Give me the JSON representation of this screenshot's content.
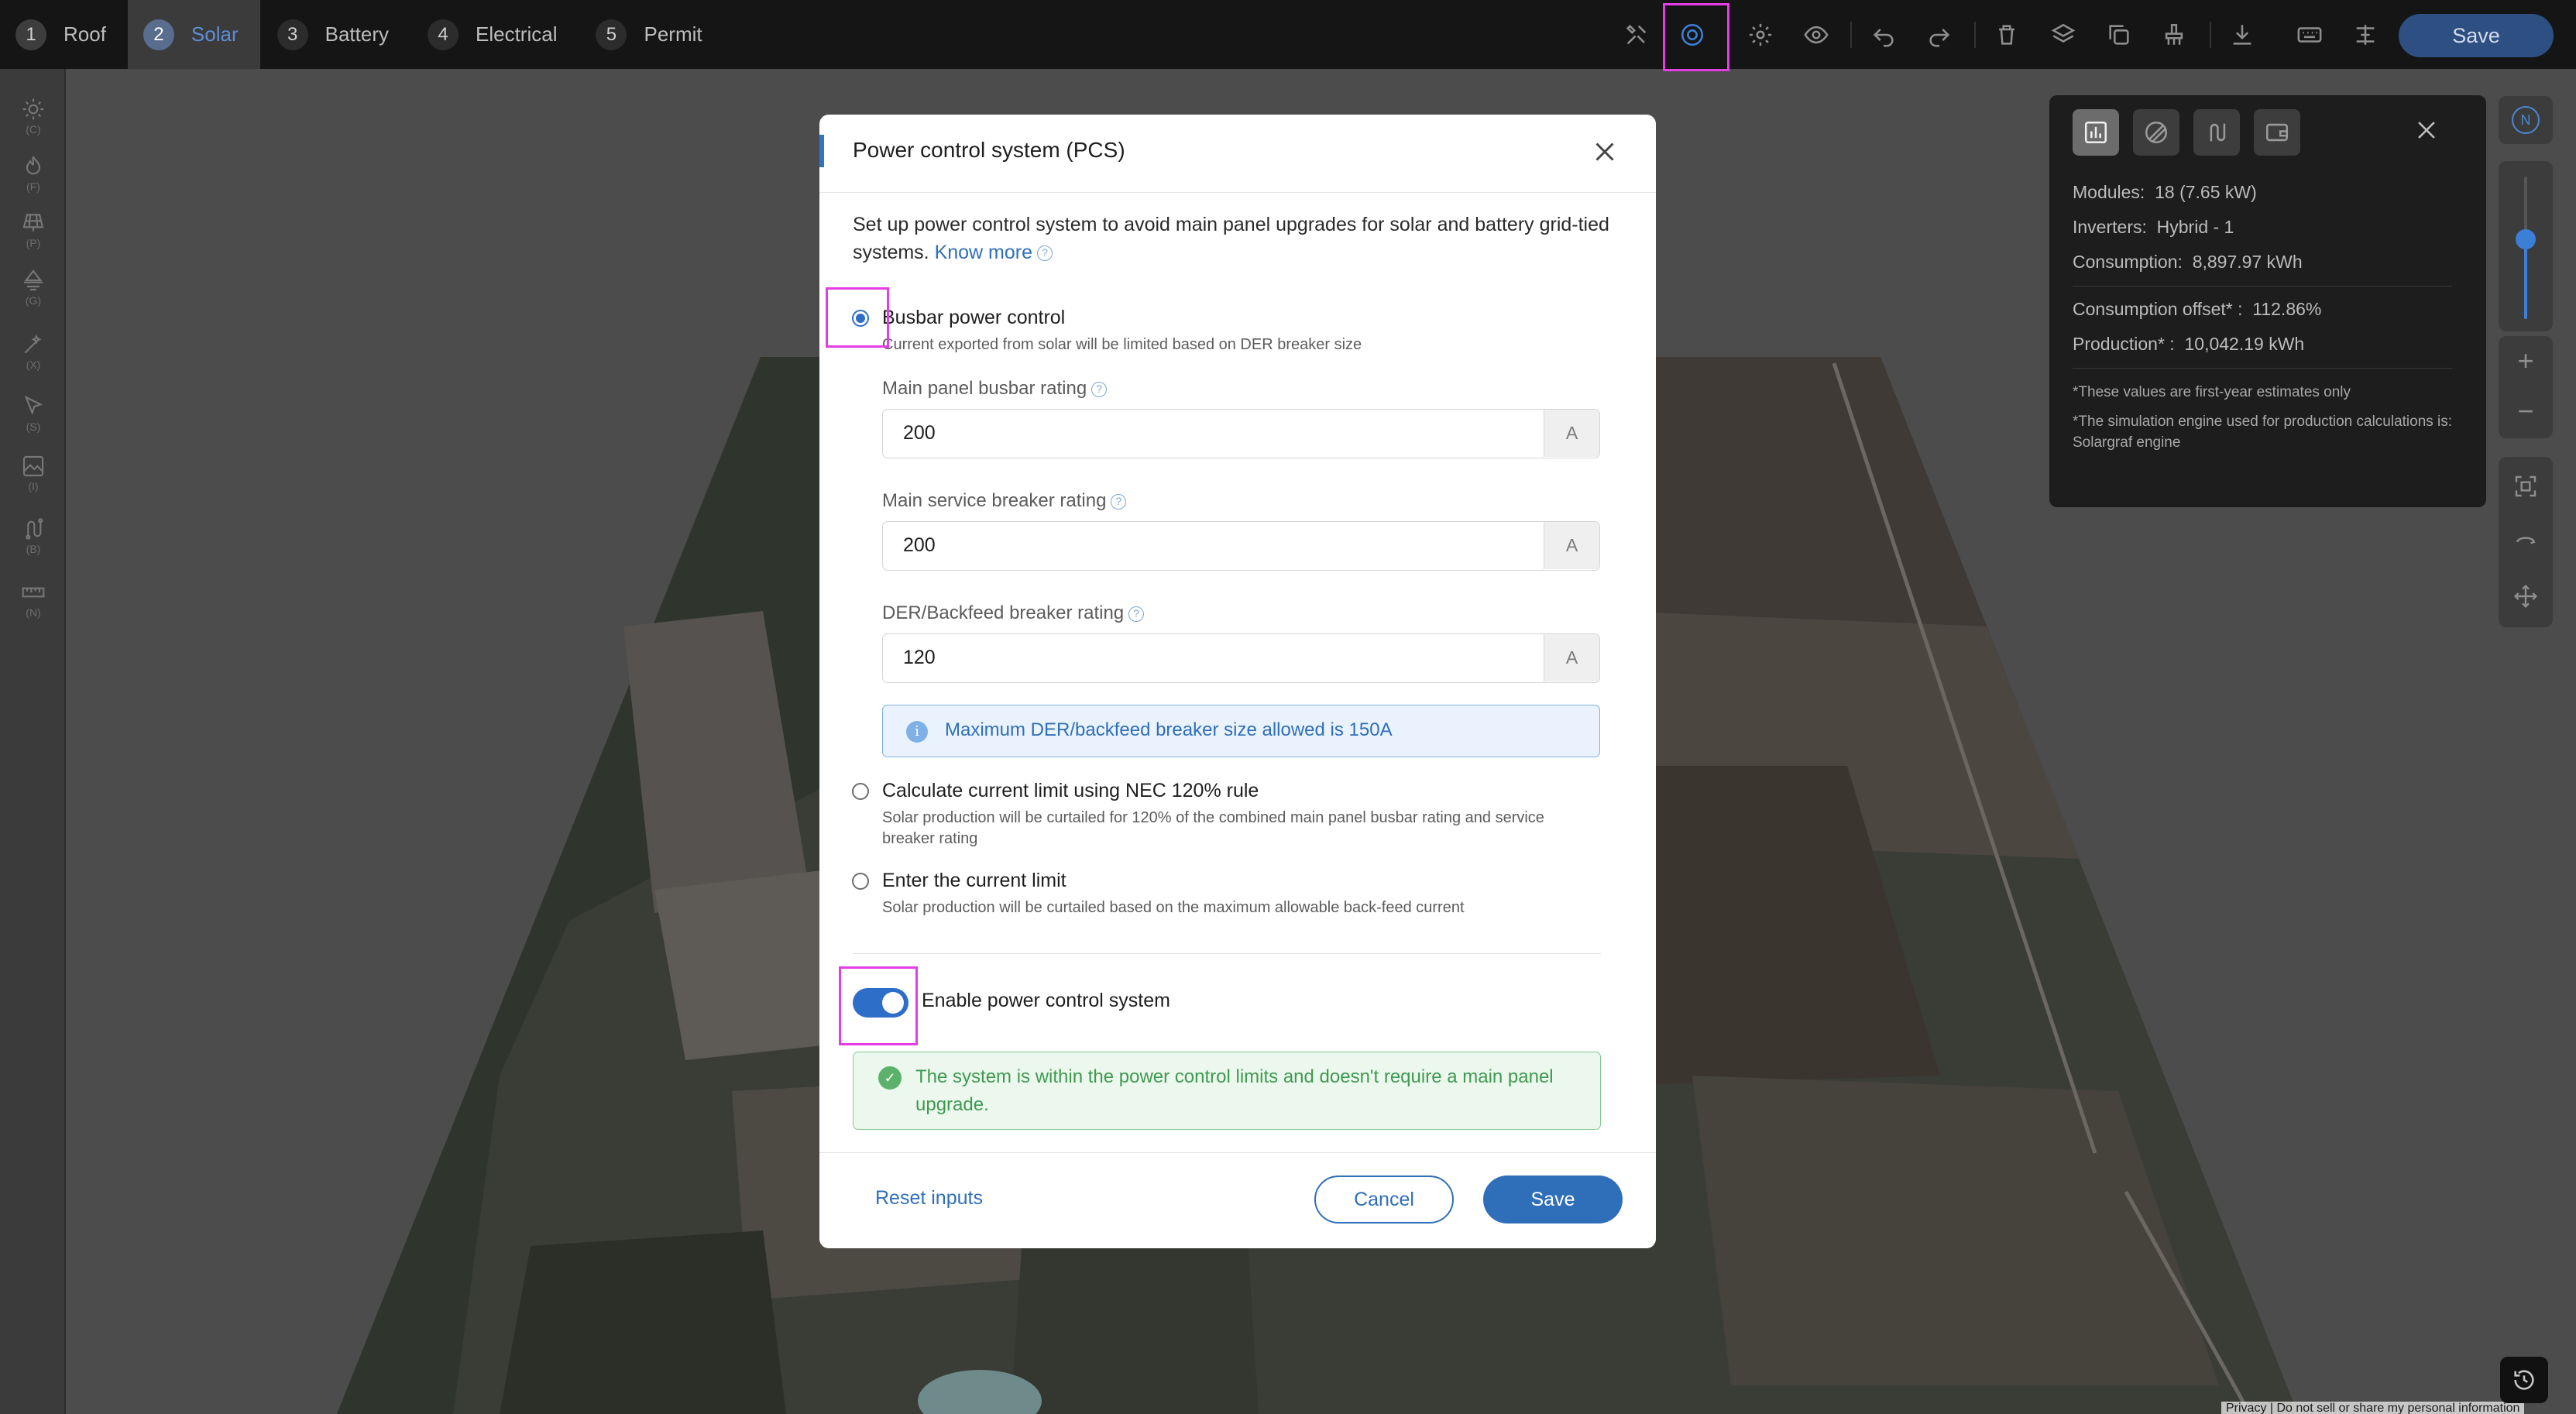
{
  "steps": [
    {
      "num": "1",
      "label": "Roof"
    },
    {
      "num": "2",
      "label": "Solar"
    },
    {
      "num": "3",
      "label": "Battery"
    },
    {
      "num": "4",
      "label": "Electrical"
    },
    {
      "num": "5",
      "label": "Permit"
    }
  ],
  "toolbar": {
    "icons": [
      "tools-icon",
      "power-control-icon",
      "gear-icon",
      "eye-icon",
      "undo-icon",
      "redo-icon",
      "trash-icon",
      "layers-icon",
      "copy-icon",
      "brush-icon",
      "download-icon",
      "keyboard-icon",
      "align-icon"
    ],
    "save_label": "Save"
  },
  "left_tools": [
    {
      "icon": "sun-icon",
      "key": "(C)"
    },
    {
      "icon": "fire-icon",
      "key": "(F)"
    },
    {
      "icon": "panel-icon",
      "key": "(P)"
    },
    {
      "icon": "ground-icon",
      "key": "(G)"
    },
    {
      "icon": "wand-icon",
      "key": "(X)"
    },
    {
      "icon": "cursor-icon",
      "key": "(S)"
    },
    {
      "icon": "image-icon",
      "key": "(I)"
    },
    {
      "icon": "route-icon",
      "key": "(B)"
    },
    {
      "icon": "ruler-icon",
      "key": "(N)"
    }
  ],
  "stats": {
    "modules_label": "Modules:",
    "modules_value": "18 (7.65 kW)",
    "inverters_label": "Inverters:",
    "inverters_value": "Hybrid - 1",
    "consumption_label": "Consumption:",
    "consumption_value": "8,897.97 kWh",
    "offset_label": "Consumption offset* :",
    "offset_value": "112.86%",
    "production_label": "Production* :",
    "production_value": "10,042.19 kWh",
    "note1": "*These values are first-year estimates only",
    "note2": "*The simulation engine used for production calculations is: Solargraf engine"
  },
  "map_controls": {
    "compass": "N"
  },
  "modal": {
    "title": "Power control system (PCS)",
    "intro": "Set up power control system to avoid main panel upgrades for solar and battery grid-tied systems.",
    "know_more": "Know more",
    "options": [
      {
        "label": "Busbar power control",
        "desc": "Current exported from solar will be limited based on DER breaker size",
        "selected": true
      },
      {
        "label": "Calculate current limit using NEC 120% rule",
        "desc": "Solar production will be curtailed for 120% of the combined main panel busbar rating and service breaker rating",
        "selected": false
      },
      {
        "label": "Enter the current limit",
        "desc": "Solar production will be curtailed based on the maximum allowable back-feed current",
        "selected": false
      }
    ],
    "fields": [
      {
        "label": "Main panel busbar rating",
        "value": "200",
        "unit": "A"
      },
      {
        "label": "Main service breaker rating",
        "value": "200",
        "unit": "A"
      },
      {
        "label": "DER/Backfeed breaker rating",
        "value": "120",
        "unit": "A"
      }
    ],
    "info": "Maximum DER/backfeed breaker size allowed is 150A",
    "toggle_label": "Enable power control system",
    "toggle_on": true,
    "success": "The system is within the power control limits and doesn't require a main panel upgrade.",
    "reset": "Reset inputs",
    "cancel": "Cancel",
    "save": "Save"
  },
  "privacy": "Privacy  |  Do not sell or share my personal information"
}
